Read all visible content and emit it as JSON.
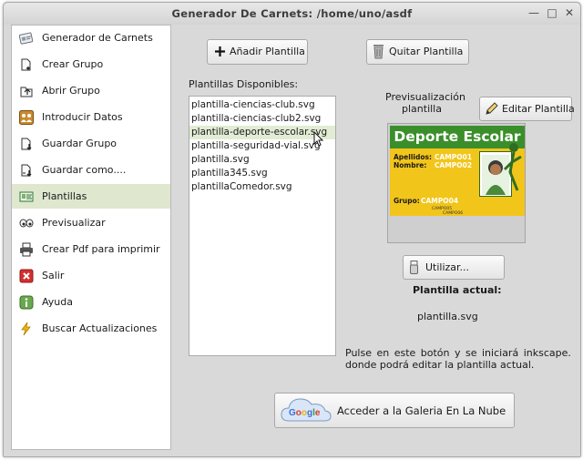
{
  "window": {
    "title": "Generador De Carnets: /home/uno/asdf"
  },
  "sidebar": {
    "items": [
      {
        "label": "Generador de Carnets"
      },
      {
        "label": "Crear Grupo"
      },
      {
        "label": "Abrir Grupo"
      },
      {
        "label": "Introducir Datos"
      },
      {
        "label": "Guardar Grupo"
      },
      {
        "label": "Guardar como...."
      },
      {
        "label": "Plantillas"
      },
      {
        "label": "Previsualizar"
      },
      {
        "label": "Crear Pdf para imprimir"
      },
      {
        "label": "Salir"
      },
      {
        "label": "Ayuda"
      },
      {
        "label": "Buscar Actualizaciones"
      }
    ],
    "active": "Plantillas"
  },
  "toolbar": {
    "add_label": "Añadir Plantilla",
    "remove_label": "Quitar Plantilla"
  },
  "templates": {
    "heading": "Plantillas Disponibles:",
    "items": [
      "plantilla-ciencias-club.svg",
      "plantilla-ciencias-club2.svg",
      "plantilla-deporte-escolar.svg",
      "plantilla-seguridad-vial.svg",
      "plantilla.svg",
      "plantilla345.svg",
      "plantillaComedor.svg"
    ]
  },
  "preview": {
    "heading_line1": "Previsualización",
    "heading_line2": "plantilla",
    "edit_label": "Editar Plantilla",
    "card": {
      "title": "Deporte Escolar",
      "apellidos_label": "Apellidos:",
      "apellidos_value": "CAMPO01",
      "nombre_label": "Nombre:",
      "nombre_value": "CAMPO02",
      "grupo_label": "Grupo:",
      "grupo_value": "CAMPO04",
      "footer1": "CAMPO05",
      "footer2": "CAMPO06"
    }
  },
  "use_button": {
    "label": "Utilizar..."
  },
  "current": {
    "heading": "Plantilla actual:",
    "value": "plantilla.svg"
  },
  "help": {
    "line1": "Pulse en este botón y se iniciará inkscape.",
    "line2": "donde podrá editar la plantilla actual."
  },
  "cloud": {
    "label": "Acceder a la Galeria En La Nube",
    "logo_text": "Google"
  },
  "colors": {
    "active_item": "#dfe7cf",
    "card_yellow": "#f2c51a",
    "card_green": "#3b8f2b"
  }
}
